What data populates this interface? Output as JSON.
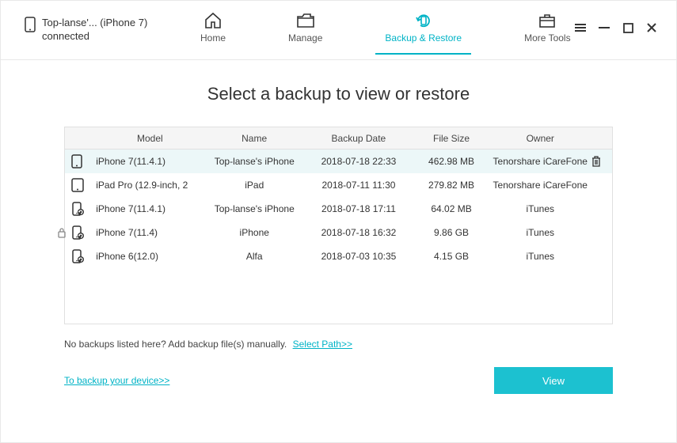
{
  "device": {
    "name_line": "Top-lanse'... (iPhone 7)",
    "status": "connected"
  },
  "nav": {
    "home": "Home",
    "manage": "Manage",
    "backup_restore": "Backup & Restore",
    "more_tools": "More Tools"
  },
  "page_title": "Select a backup to view or restore",
  "columns": {
    "model": "Model",
    "name": "Name",
    "date": "Backup Date",
    "size": "File Size",
    "owner": "Owner"
  },
  "rows": [
    {
      "icon": "phone",
      "model": "iPhone 7(11.4.1)",
      "name": "Top-lanse's iPhone",
      "date": "2018-07-18 22:33",
      "size": "462.98 MB",
      "owner": "Tenorshare iCareFone",
      "deletable": true
    },
    {
      "icon": "tablet",
      "model": "iPad Pro (12.9-inch, 2",
      "name": "iPad",
      "date": "2018-07-11 11:30",
      "size": "279.82 MB",
      "owner": "Tenorshare iCareFone"
    },
    {
      "icon": "phone-sync",
      "model": "iPhone 7(11.4.1)",
      "name": "Top-lanse's iPhone",
      "date": "2018-07-18 17:11",
      "size": "64.02 MB",
      "owner": "iTunes"
    },
    {
      "icon": "phone-sync",
      "lock": true,
      "model": "iPhone 7(11.4)",
      "name": "iPhone",
      "date": "2018-07-18 16:32",
      "size": "9.86 GB",
      "owner": "iTunes"
    },
    {
      "icon": "phone-sync",
      "model": "iPhone 6(12.0)",
      "name": "Alfa",
      "date": "2018-07-03 10:35",
      "size": "4.15 GB",
      "owner": "iTunes"
    }
  ],
  "footer": {
    "manual_text": "No backups listed here? Add backup file(s) manually.",
    "select_path": "Select Path>>",
    "to_backup": "To backup your device>>",
    "view": "View"
  },
  "accent": "#00b3c6"
}
